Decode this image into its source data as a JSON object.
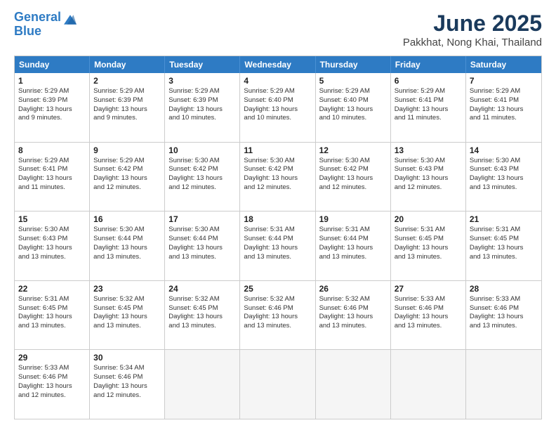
{
  "header": {
    "logo_line1": "General",
    "logo_line2": "Blue",
    "title": "June 2025",
    "subtitle": "Pakkhat, Nong Khai, Thailand"
  },
  "weekdays": [
    "Sunday",
    "Monday",
    "Tuesday",
    "Wednesday",
    "Thursday",
    "Friday",
    "Saturday"
  ],
  "rows": [
    [
      {
        "day": "1",
        "lines": [
          "Sunrise: 5:29 AM",
          "Sunset: 6:39 PM",
          "Daylight: 13 hours",
          "and 9 minutes."
        ]
      },
      {
        "day": "2",
        "lines": [
          "Sunrise: 5:29 AM",
          "Sunset: 6:39 PM",
          "Daylight: 13 hours",
          "and 9 minutes."
        ]
      },
      {
        "day": "3",
        "lines": [
          "Sunrise: 5:29 AM",
          "Sunset: 6:39 PM",
          "Daylight: 13 hours",
          "and 10 minutes."
        ]
      },
      {
        "day": "4",
        "lines": [
          "Sunrise: 5:29 AM",
          "Sunset: 6:40 PM",
          "Daylight: 13 hours",
          "and 10 minutes."
        ]
      },
      {
        "day": "5",
        "lines": [
          "Sunrise: 5:29 AM",
          "Sunset: 6:40 PM",
          "Daylight: 13 hours",
          "and 10 minutes."
        ]
      },
      {
        "day": "6",
        "lines": [
          "Sunrise: 5:29 AM",
          "Sunset: 6:41 PM",
          "Daylight: 13 hours",
          "and 11 minutes."
        ]
      },
      {
        "day": "7",
        "lines": [
          "Sunrise: 5:29 AM",
          "Sunset: 6:41 PM",
          "Daylight: 13 hours",
          "and 11 minutes."
        ]
      }
    ],
    [
      {
        "day": "8",
        "lines": [
          "Sunrise: 5:29 AM",
          "Sunset: 6:41 PM",
          "Daylight: 13 hours",
          "and 11 minutes."
        ]
      },
      {
        "day": "9",
        "lines": [
          "Sunrise: 5:29 AM",
          "Sunset: 6:42 PM",
          "Daylight: 13 hours",
          "and 12 minutes."
        ]
      },
      {
        "day": "10",
        "lines": [
          "Sunrise: 5:30 AM",
          "Sunset: 6:42 PM",
          "Daylight: 13 hours",
          "and 12 minutes."
        ]
      },
      {
        "day": "11",
        "lines": [
          "Sunrise: 5:30 AM",
          "Sunset: 6:42 PM",
          "Daylight: 13 hours",
          "and 12 minutes."
        ]
      },
      {
        "day": "12",
        "lines": [
          "Sunrise: 5:30 AM",
          "Sunset: 6:42 PM",
          "Daylight: 13 hours",
          "and 12 minutes."
        ]
      },
      {
        "day": "13",
        "lines": [
          "Sunrise: 5:30 AM",
          "Sunset: 6:43 PM",
          "Daylight: 13 hours",
          "and 12 minutes."
        ]
      },
      {
        "day": "14",
        "lines": [
          "Sunrise: 5:30 AM",
          "Sunset: 6:43 PM",
          "Daylight: 13 hours",
          "and 13 minutes."
        ]
      }
    ],
    [
      {
        "day": "15",
        "lines": [
          "Sunrise: 5:30 AM",
          "Sunset: 6:43 PM",
          "Daylight: 13 hours",
          "and 13 minutes."
        ]
      },
      {
        "day": "16",
        "lines": [
          "Sunrise: 5:30 AM",
          "Sunset: 6:44 PM",
          "Daylight: 13 hours",
          "and 13 minutes."
        ]
      },
      {
        "day": "17",
        "lines": [
          "Sunrise: 5:30 AM",
          "Sunset: 6:44 PM",
          "Daylight: 13 hours",
          "and 13 minutes."
        ]
      },
      {
        "day": "18",
        "lines": [
          "Sunrise: 5:31 AM",
          "Sunset: 6:44 PM",
          "Daylight: 13 hours",
          "and 13 minutes."
        ]
      },
      {
        "day": "19",
        "lines": [
          "Sunrise: 5:31 AM",
          "Sunset: 6:44 PM",
          "Daylight: 13 hours",
          "and 13 minutes."
        ]
      },
      {
        "day": "20",
        "lines": [
          "Sunrise: 5:31 AM",
          "Sunset: 6:45 PM",
          "Daylight: 13 hours",
          "and 13 minutes."
        ]
      },
      {
        "day": "21",
        "lines": [
          "Sunrise: 5:31 AM",
          "Sunset: 6:45 PM",
          "Daylight: 13 hours",
          "and 13 minutes."
        ]
      }
    ],
    [
      {
        "day": "22",
        "lines": [
          "Sunrise: 5:31 AM",
          "Sunset: 6:45 PM",
          "Daylight: 13 hours",
          "and 13 minutes."
        ]
      },
      {
        "day": "23",
        "lines": [
          "Sunrise: 5:32 AM",
          "Sunset: 6:45 PM",
          "Daylight: 13 hours",
          "and 13 minutes."
        ]
      },
      {
        "day": "24",
        "lines": [
          "Sunrise: 5:32 AM",
          "Sunset: 6:45 PM",
          "Daylight: 13 hours",
          "and 13 minutes."
        ]
      },
      {
        "day": "25",
        "lines": [
          "Sunrise: 5:32 AM",
          "Sunset: 6:46 PM",
          "Daylight: 13 hours",
          "and 13 minutes."
        ]
      },
      {
        "day": "26",
        "lines": [
          "Sunrise: 5:32 AM",
          "Sunset: 6:46 PM",
          "Daylight: 13 hours",
          "and 13 minutes."
        ]
      },
      {
        "day": "27",
        "lines": [
          "Sunrise: 5:33 AM",
          "Sunset: 6:46 PM",
          "Daylight: 13 hours",
          "and 13 minutes."
        ]
      },
      {
        "day": "28",
        "lines": [
          "Sunrise: 5:33 AM",
          "Sunset: 6:46 PM",
          "Daylight: 13 hours",
          "and 13 minutes."
        ]
      }
    ],
    [
      {
        "day": "29",
        "lines": [
          "Sunrise: 5:33 AM",
          "Sunset: 6:46 PM",
          "Daylight: 13 hours",
          "and 12 minutes."
        ]
      },
      {
        "day": "30",
        "lines": [
          "Sunrise: 5:34 AM",
          "Sunset: 6:46 PM",
          "Daylight: 13 hours",
          "and 12 minutes."
        ]
      },
      {
        "day": "",
        "lines": []
      },
      {
        "day": "",
        "lines": []
      },
      {
        "day": "",
        "lines": []
      },
      {
        "day": "",
        "lines": []
      },
      {
        "day": "",
        "lines": []
      }
    ]
  ]
}
